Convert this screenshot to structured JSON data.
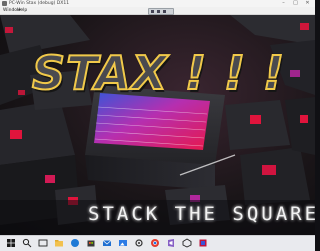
{
  "window": {
    "title": "PC-Win Stax (debug) DX11",
    "icon": "app-icon",
    "controls": {
      "minimize": "–",
      "maximize": "□",
      "close": "✕"
    }
  },
  "menu": {
    "items": [
      "Window",
      "Help"
    ]
  },
  "game": {
    "logo": "STAX ! ! !",
    "subtitle": "STACK THE SQUARE"
  },
  "taskbar": {
    "icons": [
      "windows-start-icon",
      "search-icon",
      "task-view-icon",
      "file-explorer-icon",
      "edge-icon",
      "store-icon",
      "mail-icon",
      "photos-icon",
      "settings-icon",
      "chrome-icon",
      "vs-icon",
      "unity-icon",
      "game-icon"
    ],
    "clock_time": "",
    "clock_date": ""
  },
  "colors": {
    "logo_outline": "#f1c94a",
    "logo_fill": "#4a4a4f",
    "neon_red": "#e0143c",
    "neon_magenta": "#c027a8",
    "neon_blue": "#3a6bd6"
  }
}
